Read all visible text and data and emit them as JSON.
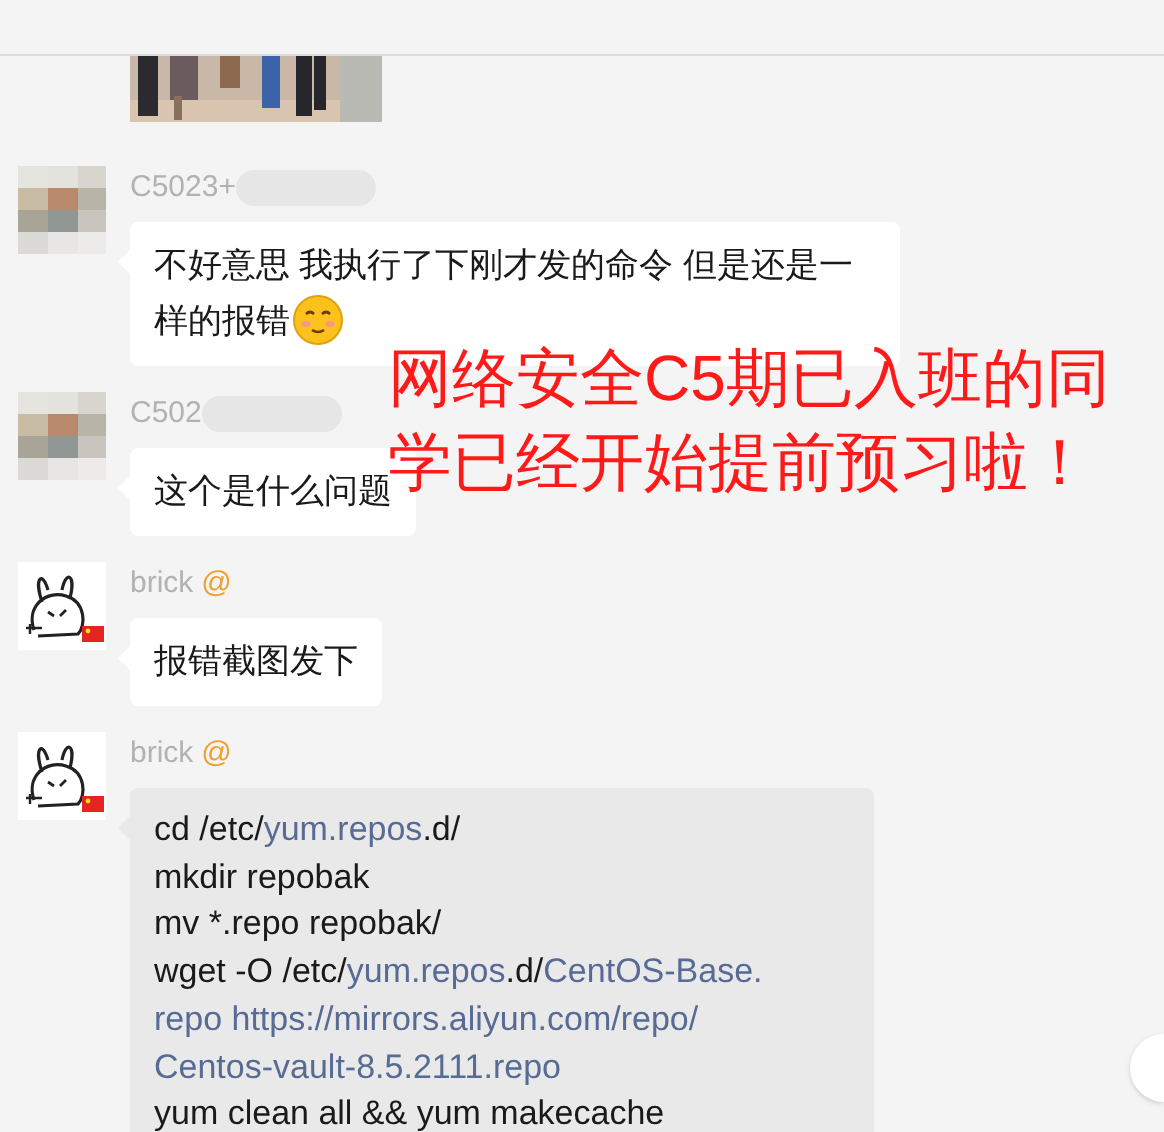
{
  "header": {
    "kind": "cut"
  },
  "shared_image": {
    "kind": "picture"
  },
  "messages": [
    {
      "kind": "text",
      "sender": "C5023+",
      "sender_redacted": true,
      "avatar": {
        "kind": "pixelated"
      },
      "emoji": true,
      "text": "不好意思 我执行了下刚才发的命令 但是还是一样的报错"
    },
    {
      "kind": "text",
      "sender": "C502",
      "sender_redacted": true,
      "avatar": {
        "kind": "pixelated"
      },
      "emoji": false,
      "text": "这个是什么问题"
    },
    {
      "kind": "text",
      "sender": "brick",
      "mention": "@",
      "sender_redacted": false,
      "avatar": {
        "kind": "rabbit"
      },
      "emoji": false,
      "text": "报错截图发下"
    },
    {
      "kind": "code",
      "sender": "brick",
      "mention": "@",
      "sender_redacted": false,
      "avatar": {
        "kind": "rabbit"
      },
      "code_lines": [
        [
          {
            "text": "cd /etc/",
            "link": false
          },
          {
            "text": "yum.repos",
            "link": true
          },
          {
            "text": ".d/",
            "link": false
          }
        ],
        [
          {
            "text": "mkdir repobak",
            "link": false
          }
        ],
        [
          {
            "text": "mv *.repo repobak/",
            "link": false
          }
        ],
        [
          {
            "text": "wget -O /etc/",
            "link": false
          },
          {
            "text": "yum.repos",
            "link": true
          },
          {
            "text": ".d/",
            "link": false
          },
          {
            "text": "CentOS-Base.",
            "link": true
          }
        ],
        [
          {
            "text": "repo https://mirrors.aliyun.com/repo/",
            "link": true
          }
        ],
        [
          {
            "text": "Centos-vault-8.5.2111.repo",
            "link": true
          }
        ],
        [
          {
            "text": "yum clean all && yum makecache",
            "link": false
          }
        ]
      ]
    }
  ],
  "overlay_caption": [
    "网络安全C5期已入班的同",
    "学已经开始提前预习啦！"
  ]
}
